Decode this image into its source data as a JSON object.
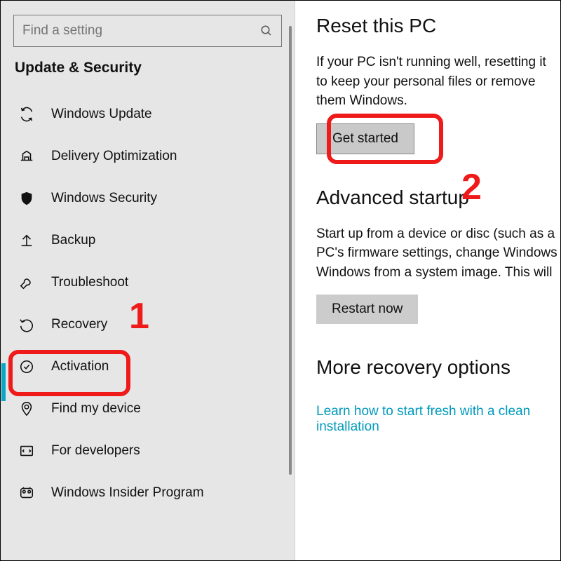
{
  "sidebar": {
    "search_placeholder": "Find a setting",
    "section_title": "Update & Security",
    "items": [
      {
        "label": "Windows Update"
      },
      {
        "label": "Delivery Optimization"
      },
      {
        "label": "Windows Security"
      },
      {
        "label": "Backup"
      },
      {
        "label": "Troubleshoot"
      },
      {
        "label": "Recovery"
      },
      {
        "label": "Activation"
      },
      {
        "label": "Find my device"
      },
      {
        "label": "For developers"
      },
      {
        "label": "Windows Insider Program"
      }
    ]
  },
  "main": {
    "reset": {
      "heading": "Reset this PC",
      "body": "If your PC isn't running well, resetting it to keep your personal files or remove them Windows.",
      "button": "Get started"
    },
    "advanced": {
      "heading": "Advanced startup",
      "body": "Start up from a device or disc (such as a PC's firmware settings, change Windows Windows from a system image. This will",
      "button": "Restart now"
    },
    "more": {
      "heading": "More recovery options",
      "link": "Learn how to start fresh with a clean installation"
    }
  },
  "annotations": {
    "one": "1",
    "two": "2"
  }
}
